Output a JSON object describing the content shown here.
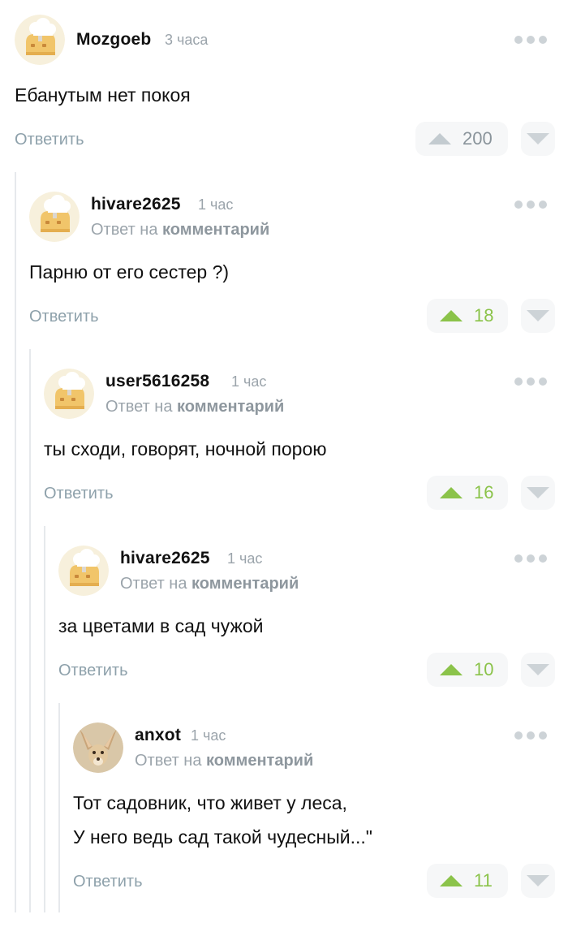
{
  "colors": {
    "positive": "#8bc34a",
    "neutral": "#c3cbd0"
  },
  "labels": {
    "reply": "Ответить",
    "reply_to_prefix": "Ответ на",
    "reply_to_target": "комментарий"
  },
  "comments": [
    {
      "username": "Mozgoeb",
      "time": "3 часа",
      "avatar": "toast-chef-icon",
      "text": [
        "Ебанутым нет покоя"
      ],
      "votes": "200",
      "vote_state": "neutral",
      "is_reply": false
    },
    {
      "username": "hivare2625",
      "time": "1 час",
      "avatar": "toast-chef-icon",
      "text": [
        "Парню от его сестер ?)"
      ],
      "votes": "18",
      "vote_state": "positive",
      "is_reply": true
    },
    {
      "username": "user5616258",
      "time": "1 час",
      "avatar": "toast-chef-icon",
      "text": [
        "ты сходи, говорят, ночной порою"
      ],
      "votes": "16",
      "vote_state": "positive",
      "is_reply": true
    },
    {
      "username": "hivare2625",
      "time": "1 час",
      "avatar": "toast-chef-icon",
      "text": [
        "за цветами в сад чужой"
      ],
      "votes": "10",
      "vote_state": "positive",
      "is_reply": true
    },
    {
      "username": "anxot",
      "time": "1 час",
      "avatar": "fennec-fox-icon",
      "text": [
        "Тот садовник, что живет у леса,",
        "У него ведь сад такой чудесный...\""
      ],
      "votes": "11",
      "vote_state": "positive",
      "is_reply": true
    }
  ]
}
